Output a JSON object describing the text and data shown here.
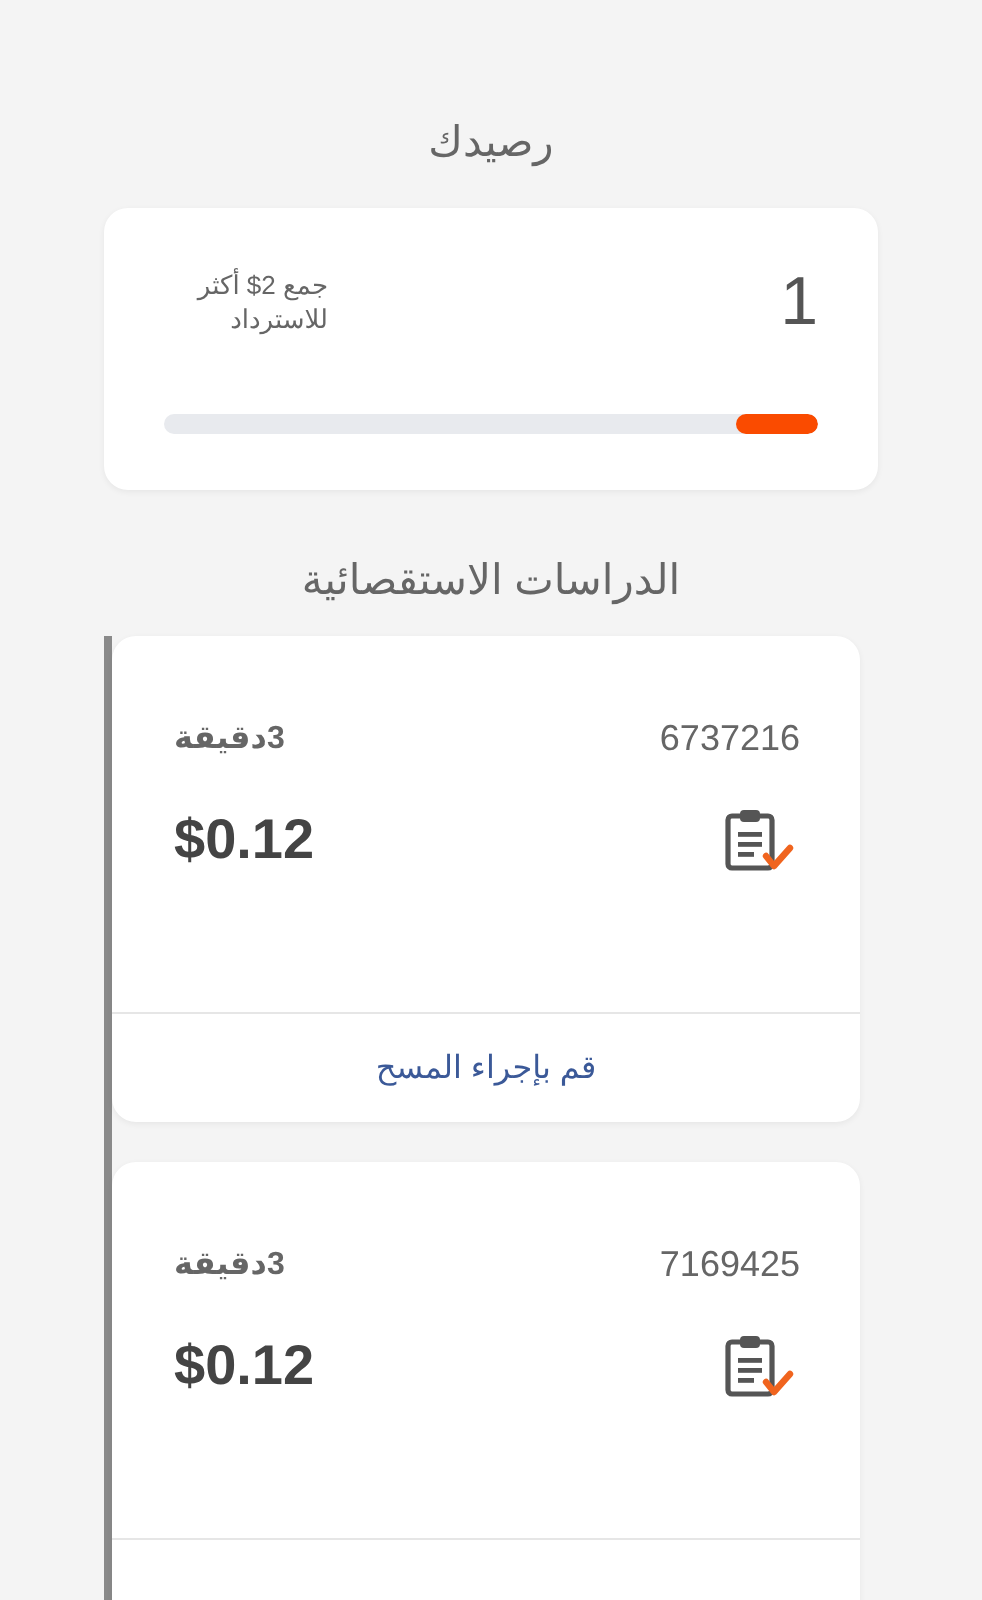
{
  "balance": {
    "title": "رصيدك",
    "value": "1",
    "note": "جمع 2$ أكثر للاسترداد",
    "level": 0.125
  },
  "surveys": {
    "title": "الدراسات الاستقصائية",
    "items": [
      {
        "id": "6737216",
        "duration": "3دقيقة",
        "reward": "$0.12",
        "action": "قم بإجراء المسح"
      },
      {
        "id": "7169425",
        "duration": "3دقيقة",
        "reward": "$0.12"
      }
    ]
  }
}
